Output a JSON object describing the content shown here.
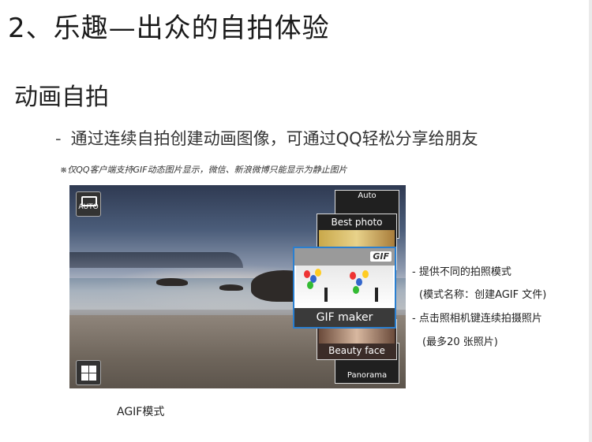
{
  "title": "2、乐趣—出众的自拍体验",
  "section": "动画自拍",
  "bullet": {
    "dash": "-",
    "text": "通过连续自拍创建动画图像，可通过QQ轻松分享给朋友"
  },
  "note": "※仅QQ客户端支持GIF动态图片显示，微信、新浪微博只能显示为静止图片",
  "camera_ui": {
    "mode_icon_label": "AUTO",
    "cards": [
      {
        "label": "Auto"
      },
      {
        "label": "Best photo"
      },
      {
        "label": "Beauty face"
      },
      {
        "label": "Panorama"
      }
    ],
    "gif_card": {
      "badge": "GIF",
      "label": "GIF maker"
    }
  },
  "side_notes": [
    "- 提供不同的拍照模式",
    "(模式名称：创建AGIF 文件)",
    "- 点击照相机键连续拍摄照片",
    "(最多20 张照片)"
  ],
  "caption": "AGIF模式"
}
